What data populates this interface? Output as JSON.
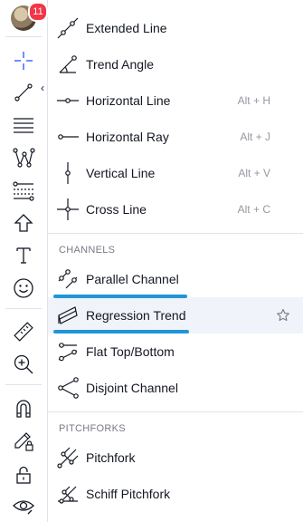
{
  "user": {
    "notification_count": "11"
  },
  "toolbar": {
    "tools": [
      "crosshair-icon",
      "trend-line-icon",
      "horizontal-lines-icon",
      "pattern-icon",
      "fib-retracement-icon",
      "arrow-up-icon",
      "text-icon",
      "emoji-icon",
      "ruler-icon",
      "zoom-in-icon",
      "magnet-icon",
      "lock-drawings-icon",
      "lock-icon",
      "eye-icon"
    ],
    "collapse_glyph": "‹"
  },
  "menu": {
    "lines": [
      {
        "label": "Extended Line",
        "shortcut": ""
      },
      {
        "label": "Trend Angle",
        "shortcut": ""
      },
      {
        "label": "Horizontal Line",
        "shortcut": "Alt + H"
      },
      {
        "label": "Horizontal Ray",
        "shortcut": "Alt + J"
      },
      {
        "label": "Vertical Line",
        "shortcut": "Alt + V"
      },
      {
        "label": "Cross Line",
        "shortcut": "Alt + C"
      }
    ],
    "channels_header": "CHANNELS",
    "channels": [
      {
        "label": "Parallel Channel"
      },
      {
        "label": "Regression Trend",
        "active": true
      },
      {
        "label": "Flat Top/Bottom"
      },
      {
        "label": "Disjoint Channel"
      }
    ],
    "pitchforks_header": "PITCHFORKS",
    "pitchforks": [
      {
        "label": "Pitchfork"
      },
      {
        "label": "Schiff Pitchfork"
      }
    ]
  },
  "colors": {
    "accent": "#2196d6",
    "active_bg": "#f0f3fa",
    "badge": "#f23645"
  }
}
